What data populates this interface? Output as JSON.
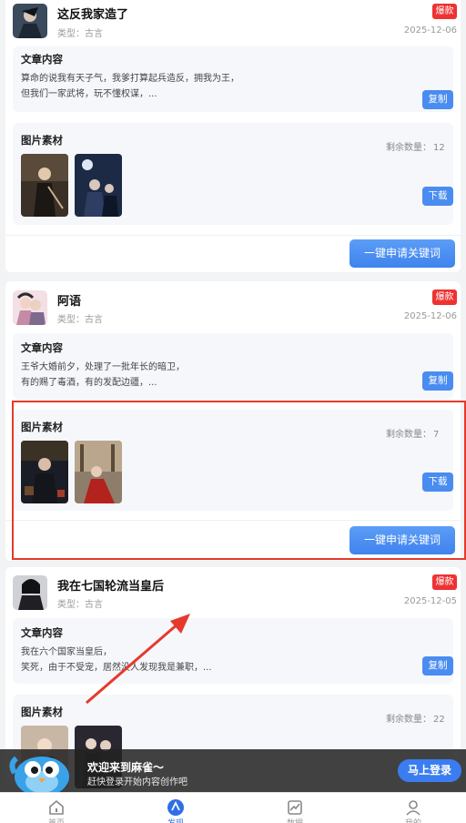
{
  "cards": [
    {
      "title": "这反我家造了",
      "badge": "爆款",
      "type_label": "类型：古言",
      "date": "2025-12-06",
      "article": {
        "title": "文章内容",
        "line1": "算命的说我有天子气，我爹打算起兵造反，拥我为王，",
        "line2": "但我们一家武将，玩不懂权谋，...",
        "copy_label": "复制"
      },
      "materials": {
        "title": "图片素材",
        "remaining_label": "剩余数量：",
        "remaining": "12",
        "download_label": "下载"
      },
      "keyword_button": "一键申请关键词"
    },
    {
      "title": "阿语",
      "badge": "爆款",
      "type_label": "类型：古言",
      "date": "2025-12-06",
      "article": {
        "title": "文章内容",
        "line1": "王爷大婚前夕，处理了一批年长的暗卫，",
        "line2": "有的赐了毒酒，有的发配边疆，...",
        "copy_label": "复制"
      },
      "materials": {
        "title": "图片素材",
        "remaining_label": "剩余数量：",
        "remaining": "7",
        "download_label": "下载"
      },
      "keyword_button": "一键申请关键词"
    },
    {
      "title": "我在七国轮流当皇后",
      "badge": "爆款",
      "type_label": "类型：古言",
      "date": "2025-12-05",
      "article": {
        "title": "文章内容",
        "line1": "我在六个国家当皇后，",
        "line2": "笑死，由于不受宠，居然没人发现我是兼职，...",
        "copy_label": "复制"
      },
      "materials": {
        "title": "图片素材",
        "remaining_label": "剩余数量：",
        "remaining": "22"
      }
    }
  ],
  "login_banner": {
    "welcome": "欢迎来到麻雀～",
    "subtext": "赶快登录开始内容创作吧",
    "button": "马上登录"
  },
  "tabbar": {
    "items": [
      {
        "label": "首页",
        "icon": "home-icon"
      },
      {
        "label": "发现",
        "icon": "compass-icon",
        "active": true
      },
      {
        "label": "数据",
        "icon": "chart-icon"
      },
      {
        "label": "我的",
        "icon": "user-icon"
      }
    ]
  },
  "colors": {
    "accent": "#3f83ee",
    "badge": "#ee3232",
    "highlight": "#e53a2c",
    "arrow": "#e53a2c",
    "page_bg": "#f2f3f5"
  }
}
